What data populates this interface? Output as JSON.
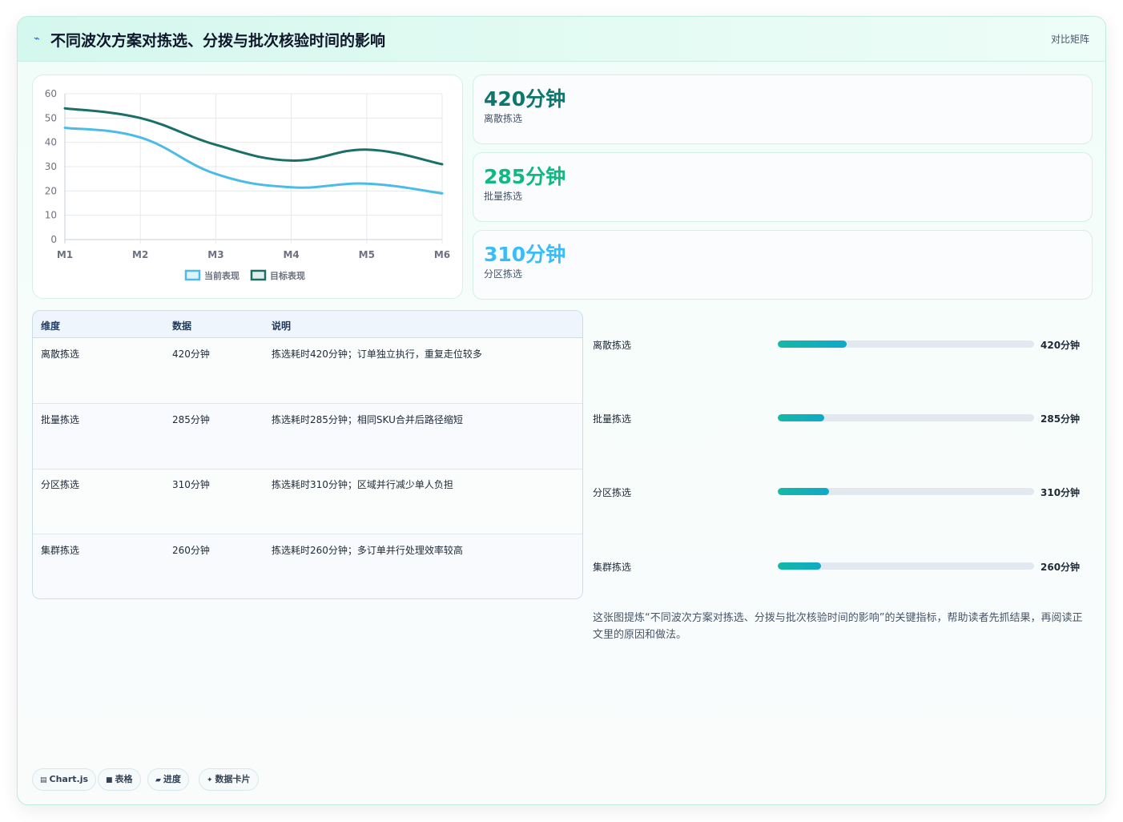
{
  "header": {
    "logo_icon": "⌁",
    "title": "不同波次方案对拣选、分拨与批次核验时间的影响",
    "tag": "对比矩阵"
  },
  "colors": {
    "series_current": "#4cbbe8",
    "series_target": "#1a6f66",
    "stat_1": "#0f766e",
    "stat_2": "#10b981",
    "stat_3": "#38bdf8"
  },
  "chart_data": {
    "type": "line",
    "title": "",
    "xlabel": "",
    "ylabel": "",
    "categories": [
      "M1",
      "M2",
      "M3",
      "M4",
      "M5",
      "M6"
    ],
    "ylim": [
      0,
      60
    ],
    "yticks": [
      0,
      10,
      20,
      30,
      40,
      50,
      60
    ],
    "grid": true,
    "legend_position": "bottom",
    "series": [
      {
        "name": "当前表现",
        "values": [
          46,
          42,
          27,
          21.5,
          23,
          19
        ]
      },
      {
        "name": "目标表现",
        "values": [
          54,
          50,
          39,
          32.5,
          37,
          31
        ]
      }
    ]
  },
  "stats": [
    {
      "value": "420分钟",
      "label": "离散拣选"
    },
    {
      "value": "285分钟",
      "label": "批量拣选"
    },
    {
      "value": "310分钟",
      "label": "分区拣选"
    }
  ],
  "table": {
    "headers": [
      "维度",
      "数据",
      "说明"
    ],
    "rows": [
      [
        "离散拣选",
        "420分钟",
        "拣选耗时420分钟；订单独立执行，重复走位较多"
      ],
      [
        "批量拣选",
        "285分钟",
        "拣选耗时285分钟；相同SKU合并后路径缩短"
      ],
      [
        "分区拣选",
        "310分钟",
        "拣选耗时310分钟；区域并行减少单人负担"
      ],
      [
        "集群拣选",
        "260分钟",
        "拣选耗时260分钟；多订单并行处理效率较高"
      ]
    ]
  },
  "progress": [
    {
      "label": "离散拣选",
      "value": "420分钟",
      "fraction": 0.27
    },
    {
      "label": "批量拣选",
      "value": "285分钟",
      "fraction": 0.18
    },
    {
      "label": "分区拣选",
      "value": "310分钟",
      "fraction": 0.2
    },
    {
      "label": "集群拣选",
      "value": "260分钟",
      "fraction": 0.17
    }
  ],
  "summary": "这张图提炼“不同波次方案对拣选、分拨与批次核验时间的影响”的关键指标，帮助读者先抓结果，再阅读正文里的原因和做法。",
  "chips": [
    {
      "icon": "▤",
      "label": "Chart.js"
    },
    {
      "icon": "■",
      "label": "表格"
    },
    {
      "icon": "▰",
      "label": "进度"
    },
    {
      "icon": "✦",
      "label": "数据卡片"
    }
  ]
}
